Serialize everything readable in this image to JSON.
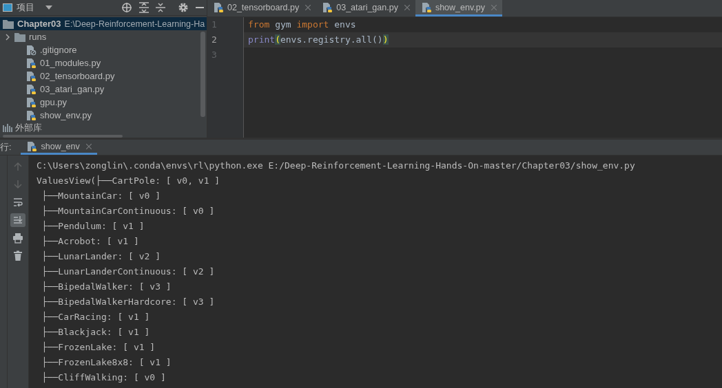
{
  "project_panel": {
    "title": "项目",
    "tree": [
      {
        "name": "Chapter03",
        "path": "E:\\Deep-Reinforcement-Learning-Ha",
        "kind": "folder",
        "selected": true,
        "children": [
          {
            "name": "runs",
            "kind": "folder",
            "selected": false,
            "expanded": false
          },
          {
            "name": ".gitignore",
            "kind": "ignore",
            "selected": false
          },
          {
            "name": "01_modules.py",
            "kind": "python",
            "selected": false
          },
          {
            "name": "02_tensorboard.py",
            "kind": "python",
            "selected": false
          },
          {
            "name": "03_atari_gan.py",
            "kind": "python",
            "selected": false
          },
          {
            "name": "gpu.py",
            "kind": "python",
            "selected": false
          },
          {
            "name": "show_env.py",
            "kind": "python",
            "selected": false
          }
        ]
      }
    ],
    "library": "外部库"
  },
  "editor": {
    "tabs": [
      {
        "label": "02_tensorboard.py",
        "selected": false
      },
      {
        "label": "03_atari_gan.py",
        "selected": false
      },
      {
        "label": "show_env.py",
        "selected": true
      }
    ],
    "lines": [
      {
        "number": "1",
        "current": false,
        "tokens": [
          {
            "kind": "keyword",
            "text": "from"
          },
          {
            "kind": "plain",
            "text": " gym "
          },
          {
            "kind": "keyword",
            "text": "import"
          },
          {
            "kind": "plain",
            "text": " envs"
          }
        ]
      },
      {
        "number": "2",
        "current": true,
        "tokens": [
          {
            "kind": "builtin",
            "text": "print"
          },
          {
            "kind": "match",
            "text": "("
          },
          {
            "kind": "plain",
            "text": "envs.registry.all()"
          },
          {
            "kind": "match",
            "text": ")"
          }
        ]
      },
      {
        "number": "3",
        "current": false
      }
    ]
  },
  "run_panel": {
    "label": "行:",
    "tab": {
      "label": "show_env",
      "selected": true
    },
    "tools": [
      {
        "kind": "up",
        "selected": false
      },
      {
        "kind": "down",
        "selected": false
      },
      {
        "kind": "wrap",
        "selected": false
      },
      {
        "kind": "scroll",
        "selected": true
      },
      {
        "kind": "print",
        "selected": false
      },
      {
        "kind": "trash",
        "selected": false
      }
    ],
    "console": [
      "C:\\Users\\zonglin\\.conda\\envs\\rl\\python.exe E:/Deep-Reinforcement-Learning-Hands-On-master/Chapter03/show_env.py",
      "ValuesView(├──CartPole: [ v0, v1 ]",
      " ├──MountainCar: [ v0 ]",
      " ├──MountainCarContinuous: [ v0 ]",
      " ├──Pendulum: [ v1 ]",
      " ├──Acrobot: [ v1 ]",
      " ├──LunarLander: [ v2 ]",
      " ├──LunarLanderContinuous: [ v2 ]",
      " ├──BipedalWalker: [ v3 ]",
      " ├──BipedalWalkerHardcore: [ v3 ]",
      " ├──CarRacing: [ v1 ]",
      " ├──Blackjack: [ v1 ]",
      " ├──FrozenLake: [ v1 ]",
      " ├──FrozenLake8x8: [ v1 ]",
      " ├──CliffWalking: [ v0 ]"
    ]
  }
}
